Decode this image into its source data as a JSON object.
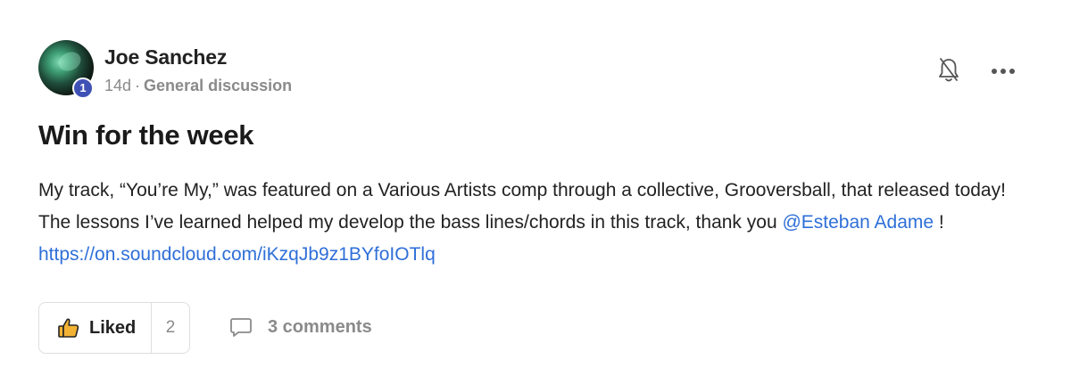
{
  "author": {
    "name": "Joe Sanchez",
    "rank_badge": "1",
    "time_ago": "14d",
    "separator": "·",
    "category": "General discussion"
  },
  "post": {
    "title": "Win for the week",
    "body_intro": "My track, “You’re My,” was featured on a Various Artists comp through a collective, Grooversball, that released today! The lessons I’ve learned helped my develop the bass lines/chords in this track, thank you ",
    "mention": "@Esteban Adame",
    "body_after_mention": " ! ",
    "link": "https://on.soundcloud.com/iKzqJb9z1BYfoIOTlq"
  },
  "actions": {
    "like_label": "Liked",
    "like_count": "2",
    "comments_label": "3 comments"
  },
  "icons": {
    "bell": "bell-off-icon",
    "more": "more-horizontal-icon",
    "thumb": "thumbs-up-icon",
    "comment": "comment-bubble-icon"
  },
  "colors": {
    "link": "#2f6fd8",
    "badge": "#3f51b5",
    "muted": "#8a8a8a"
  }
}
